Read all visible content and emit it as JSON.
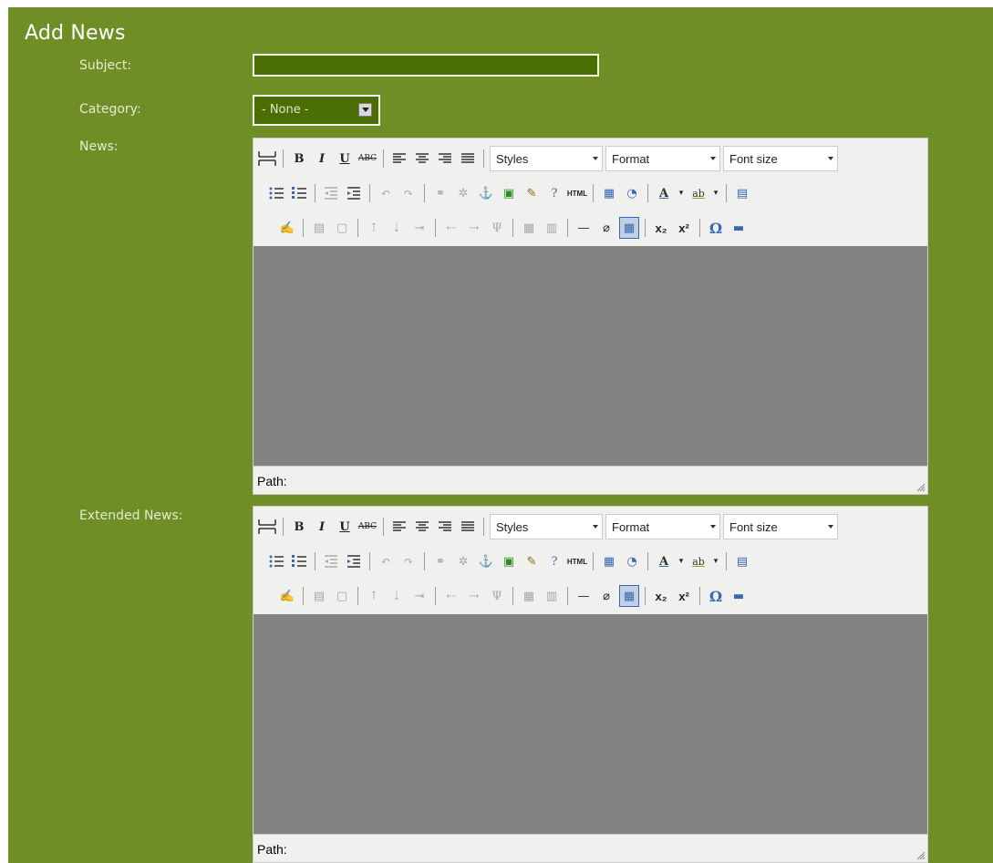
{
  "form": {
    "title": "Add News",
    "subject_label": "Subject:",
    "subject_value": "",
    "category_label": "Category:",
    "category_value": "- None -",
    "news_label": "News:",
    "extended_label": "Extended News:"
  },
  "editor": {
    "styles_label": "Styles",
    "format_label": "Format",
    "fontsize_label": "Font size",
    "path_label": "Path:",
    "b": "B",
    "i": "I",
    "u": "U",
    "abc": "ABC",
    "html": "HTML",
    "sub": "x₂",
    "sup": "x²",
    "omega": "Ω",
    "a": "A",
    "ab": "ab"
  },
  "colors": {
    "panel": "#6f8e26",
    "input_bg": "#4a6e04",
    "editor_content": "#838383",
    "toolbar_bg": "#f0f0ee"
  }
}
